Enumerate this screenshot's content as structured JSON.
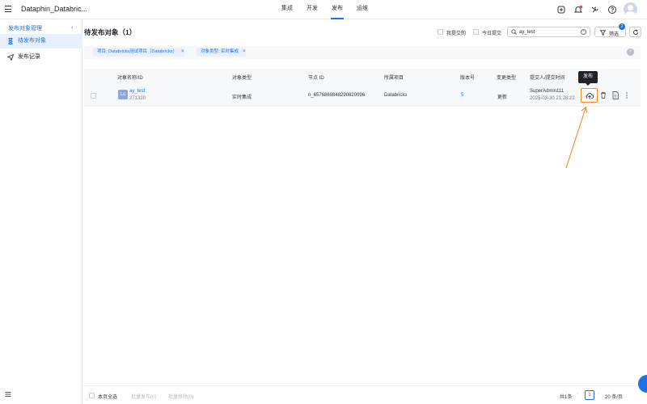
{
  "header": {
    "app_title": "Dataphin_Databric...",
    "nav": [
      "集成",
      "开发",
      "发布",
      "运维"
    ],
    "active_nav": "发布"
  },
  "sidebar": {
    "group_label": "发布对象管理",
    "items": [
      {
        "label": "待发布对象",
        "active": true
      },
      {
        "label": "发布记录",
        "active": false
      }
    ]
  },
  "main": {
    "title": "待发布对象（1）",
    "filters": {
      "mine_label": "我提交的",
      "today_label": "今日提交"
    },
    "search": {
      "value": "ay_test"
    },
    "filter_button": {
      "label": "筛选",
      "badge": "2"
    },
    "tags": [
      "项目: Databricks测试项目（Databricks）",
      "对象类型: 实时集成"
    ],
    "table": {
      "columns": [
        "对象名称/ID",
        "对象类型",
        "节点 ID",
        "所属项目",
        "版本号",
        "变更类型",
        "提交人/提交时间"
      ],
      "rows": [
        {
          "icon_text": "Lc",
          "name": "ay_test",
          "id": "271320",
          "type": "实时集成",
          "node_id": "n_6576869848290820096",
          "project": "Databricks",
          "version": "5",
          "change_type": "更新",
          "submitter": "SuperAdmin111",
          "submit_time": "2025-03-30 21:28:22"
        }
      ]
    },
    "tooltip": "发布",
    "footer": {
      "select_page": "本页全选",
      "batch_publish": "批量发布(0)",
      "batch_remove": "批量移除(0)",
      "total": "共1条",
      "page": "1",
      "page_size": "20 条/页"
    }
  },
  "colors": {
    "accent": "#1f6fe5",
    "highlight": "#f08a24"
  }
}
